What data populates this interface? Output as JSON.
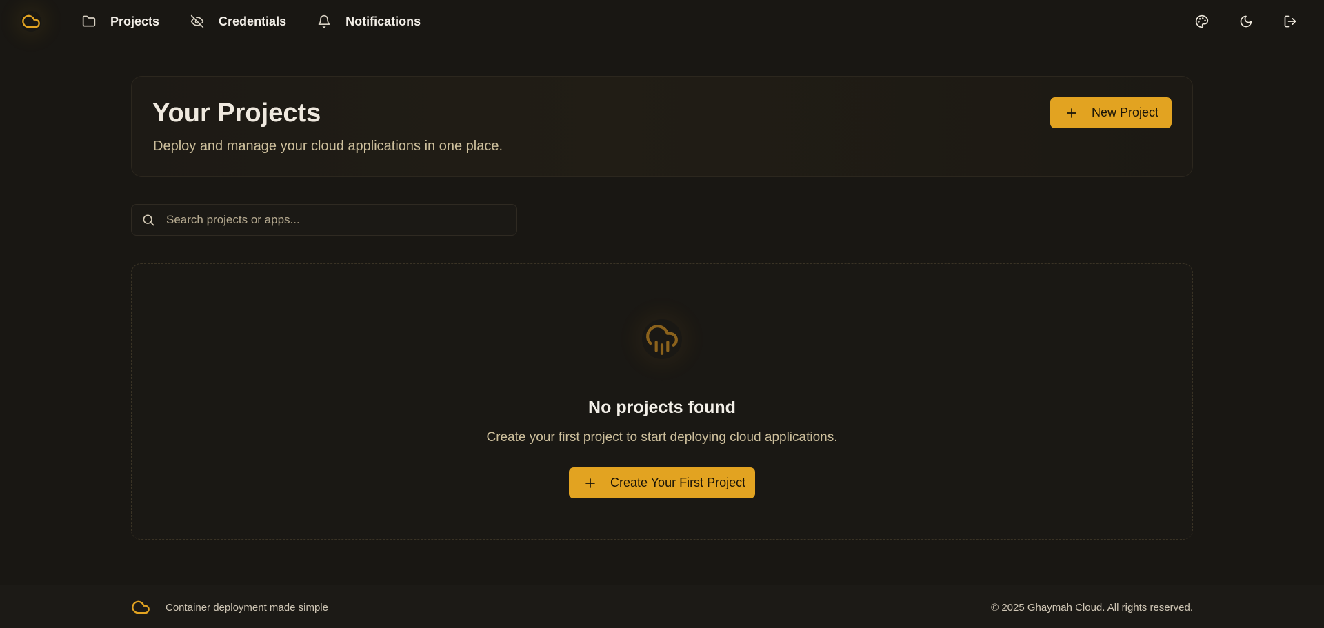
{
  "colors": {
    "accent": "#e2a321",
    "background": "#191713",
    "muted_text": "#cdbf9c"
  },
  "nav": {
    "logo_icon": "cloud-icon",
    "items": [
      {
        "label": "Projects",
        "icon": "folder-icon"
      },
      {
        "label": "Credentials",
        "icon": "eye-off-icon"
      },
      {
        "label": "Notifications",
        "icon": "bell-icon"
      }
    ],
    "actions": [
      {
        "icon": "palette-icon"
      },
      {
        "icon": "moon-icon"
      },
      {
        "icon": "logout-icon"
      }
    ]
  },
  "hero": {
    "title": "Your Projects",
    "subtitle": "Deploy and manage your cloud applications in one place.",
    "new_project_label": "New Project"
  },
  "search": {
    "placeholder": "Search projects or apps...",
    "value": ""
  },
  "empty_state": {
    "icon": "cloud-rain-icon",
    "title": "No projects found",
    "subtitle": "Create your first project to start deploying cloud applications.",
    "button_label": "Create Your First Project"
  },
  "footer": {
    "tagline": "Container deployment made simple",
    "copyright": "© 2025 Ghaymah Cloud. All rights reserved."
  }
}
